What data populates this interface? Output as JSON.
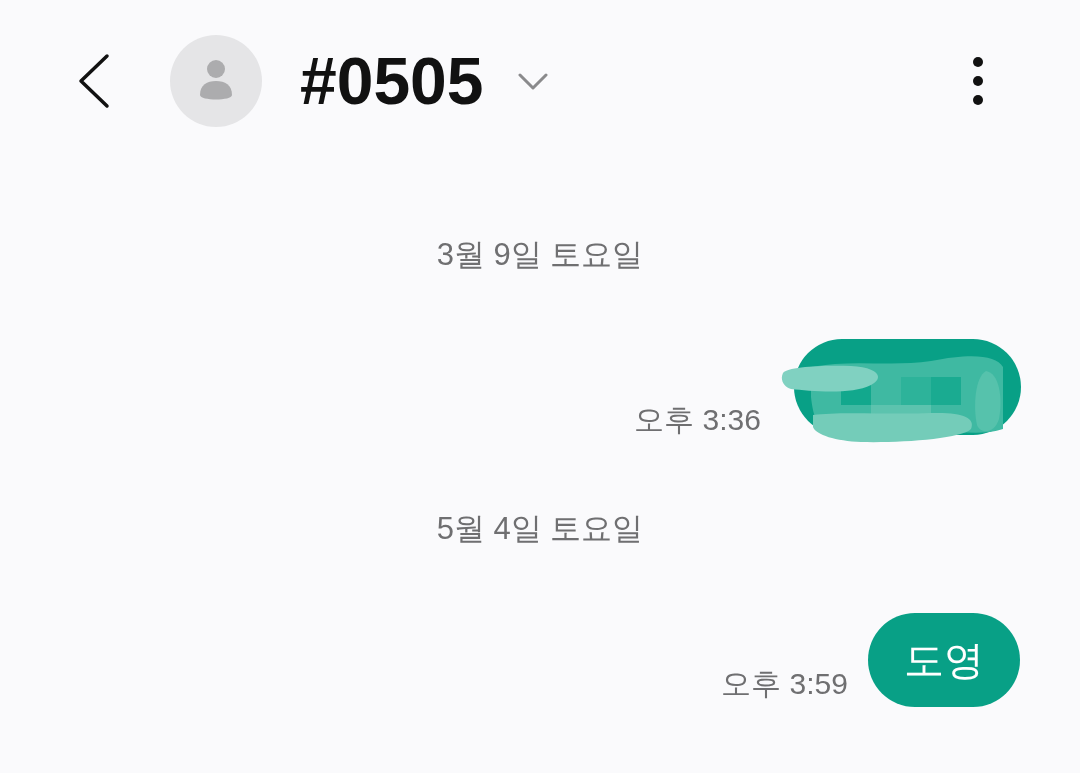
{
  "header": {
    "title": "#0505"
  },
  "conversation": [
    {
      "kind": "date",
      "text": "3월 9일 토요일"
    },
    {
      "kind": "message",
      "redacted": true,
      "time": "오후 3:36"
    },
    {
      "kind": "date",
      "text": "5월 4일 토요일"
    },
    {
      "kind": "message",
      "redacted": false,
      "text": "도영",
      "time": "오후 3:59"
    }
  ]
}
